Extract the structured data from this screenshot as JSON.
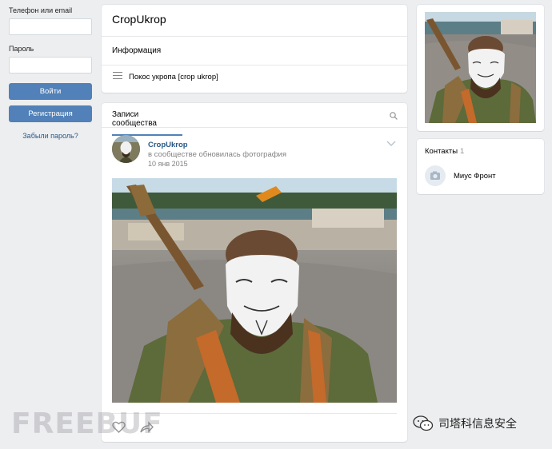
{
  "login": {
    "phone_label": "Телефон или email",
    "phone_value": "",
    "password_label": "Пароль",
    "password_value": "",
    "login_button": "Войти",
    "register_button": "Регистрация",
    "forgot_link": "Забыли пароль?"
  },
  "community": {
    "title": "CropUkrop",
    "info_label": "Информация",
    "description": "Покос укропа [crop ukrop]"
  },
  "wall": {
    "tab_label": "Записи сообщества",
    "post": {
      "author": "CropUkrop",
      "action": "в сообществе обновилась фотография",
      "date": "10 янв 2015"
    }
  },
  "contacts": {
    "title": "Контакты",
    "count": "1",
    "items": [
      {
        "name": "Миус Фронт"
      }
    ]
  },
  "watermarks": {
    "left": "FREEBUF",
    "right": "司塔科信息安全"
  },
  "colors": {
    "background": "#edeef0",
    "accent": "#5181b8",
    "link": "#2a5885",
    "muted": "#828282"
  }
}
